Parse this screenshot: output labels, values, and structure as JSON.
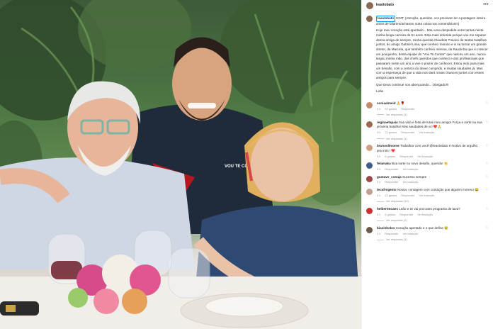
{
  "post": {
    "username": "leaolobato",
    "caption_tag": "leaolobato",
    "caption_paragraphs": [
      "EDIT: (Atenção, queridos, vcs precisam ler a postagem inteira antes de falarem/acharem outra coisa nos comentários!!!)",
      "Hoje meu coração está apertado... Meu uma despedida entre tantas nesta minha longa carreira de 51 anos. Esta mais dolorida porque vou me separar dessa amiga de sempre, minha querida Claudete Troiano de tantas batalhas juntos, do amigo Gabriel Lima, que conheci menino e vi se tornar um grande diretor, da Marcela, que também conheci menina, da Rauzinha que vi crescer um pouquinho, desta equipe do \"Vou Te Contar\" que nasceu um ano, nunca largou minha mão, dos chefs queridos que conheci e dos profissionais que passaram neste um ano a vive o prazer de conhecer. Estou indo para mais um desafio, com a certeza do dever cumprido, e muitas saudades já. Mas com a esperança de que a vida nos dará novas chances juntos com esses amigos para sempre.",
      "Que Deus continue nos abençoando... Obrigado!!!",
      "Leão"
    ]
  },
  "comments": [
    {
      "user": "soniaalmeid",
      "text": "🙏🌹",
      "age": "3 h",
      "likes": "92 gostos",
      "reply": "Responder",
      "replies": "Ver respostas (1)"
    },
    {
      "user": "reginaetapaia",
      "text": "Sua vida é feita de lutas meu amigo! Força e sorte na sua próxima batalha! Mas saudades de vc! ❤️🙏",
      "age": "3 h",
      "likes": "72 gostos",
      "reply": "Responder",
      "translate": "Ver tradução",
      "replies": "Ver respostas (1)"
    },
    {
      "user": "brunoslimome",
      "text": "Trabalhar com você @leaolobato é motivo de orgulho pra mim ! ❤️",
      "age": "3 h",
      "likes": "6 gostos",
      "reply": "Responder",
      "translate": "Ver tradução"
    },
    {
      "user": "felamaka",
      "text": "Boa sorte no novo desafio, querido! 👏",
      "age": "3 h",
      "likes": "",
      "reply": "Responder",
      "translate": "Ver tradução"
    },
    {
      "user": "gustavo_conaja",
      "text": "Sucesso sempre",
      "age": "3 h",
      "likes": "",
      "reply": "Responder",
      "translate": "Ver tradução"
    },
    {
      "user": "tecafrogenio",
      "text": "Nossa, contagem com contação que alguém morreu! 😂",
      "age": "4 h",
      "likes": "21 gostos",
      "reply": "Responder",
      "translate": "Ver tradução",
      "replies": "Ver respostas (12)"
    },
    {
      "user": "helbertmoaes",
      "text": "Leão e Sr vai pra outro programa de tava?",
      "age": "3 h",
      "likes": "6 gostos",
      "reply": "Responder",
      "translate": "Ver tradução",
      "replies": "Ver respostas (2)"
    },
    {
      "user": "biasinholos",
      "text": "Coração apertado e o que define 😢",
      "age": "3 h",
      "likes": "",
      "reply": "Responder",
      "translate": "Ver tradução",
      "replies": "Ver respostas (1)"
    }
  ],
  "photo": {
    "shirt_text": "VOU TE CONTAR"
  },
  "colors": {
    "accent_blue": "#0095f6",
    "link_blue": "#00376b",
    "muted": "#8e8e8e"
  }
}
